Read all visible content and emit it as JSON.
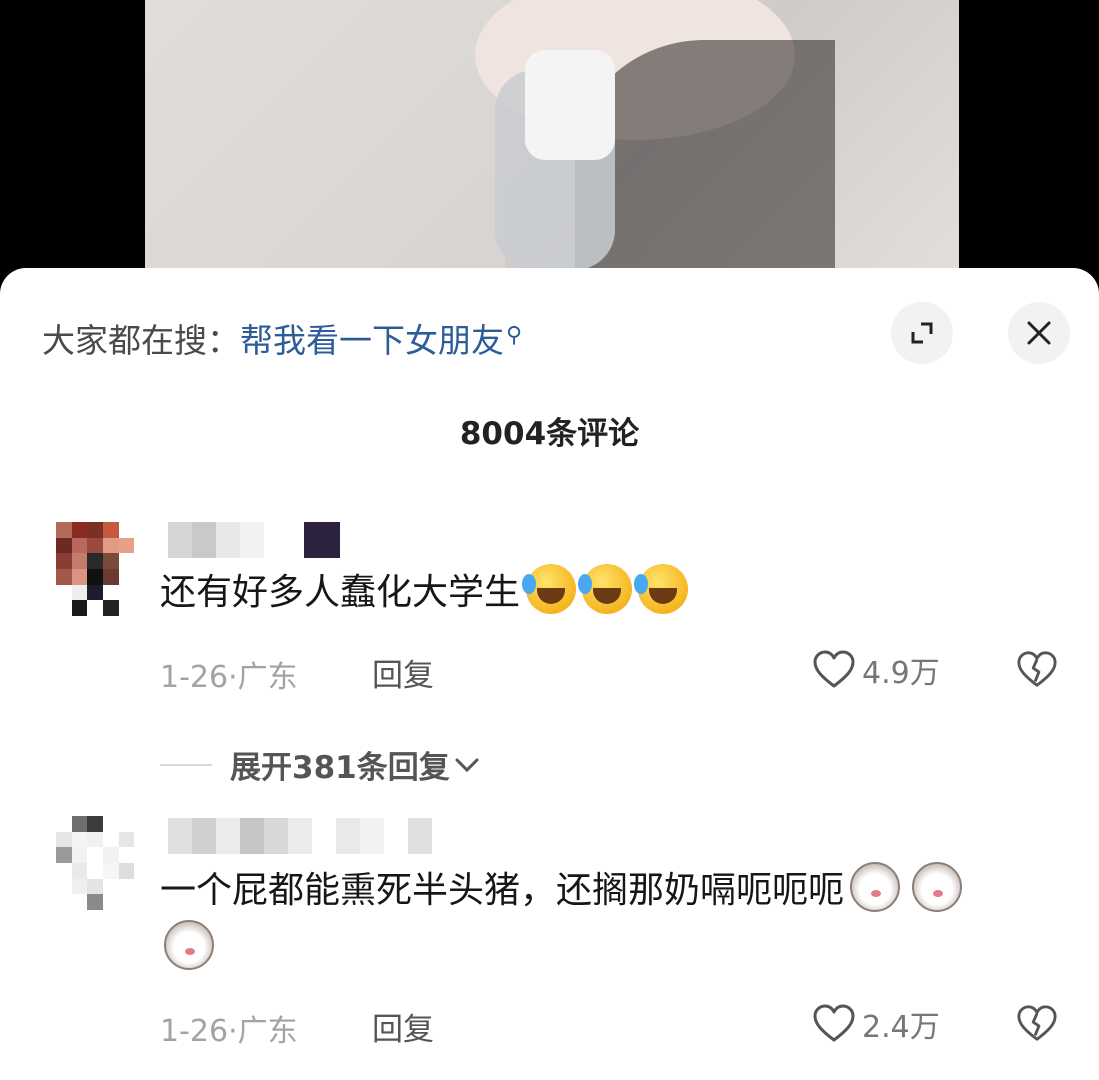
{
  "search": {
    "prefix": "大家都在搜：",
    "term": "帮我看一下女朋友"
  },
  "comments_header": {
    "count_label": "8004条评论"
  },
  "comments": [
    {
      "text": "还有好多人蠢化大学生",
      "date": "1-26",
      "location": "广东",
      "reply_label": "回复",
      "likes": "4.9万",
      "expand_label": "展开381条回复"
    },
    {
      "text": "一个屁都能熏死半头猪，还搁那奶嗝呃呃呃",
      "date": "1-26",
      "location": "广东",
      "reply_label": "回复",
      "likes": "2.4万"
    }
  ],
  "icons": {
    "search_suffix": "search-small-icon",
    "expand": "fullscreen-icon",
    "close": "close-icon",
    "like": "heart-outline-icon",
    "dislike": "broken-heart-icon",
    "chevron": "chevron-down-icon"
  },
  "colors": {
    "search_term": "#2e5c99",
    "meta_text": "#a3a3a3",
    "sheet_bg": "#ffffff"
  }
}
